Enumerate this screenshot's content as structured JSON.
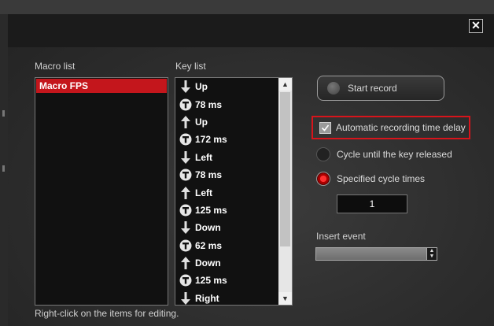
{
  "window": {
    "close_glyph": "✕"
  },
  "macro_list": {
    "label": "Macro list",
    "items": [
      "Macro FPS"
    ]
  },
  "key_list": {
    "label": "Key list",
    "items": [
      {
        "icon": "arrow-down-icon",
        "text": "Up"
      },
      {
        "icon": "timer-icon",
        "text": "78 ms"
      },
      {
        "icon": "arrow-up-icon",
        "text": "Up"
      },
      {
        "icon": "timer-icon",
        "text": "172 ms"
      },
      {
        "icon": "arrow-down-icon",
        "text": "Left"
      },
      {
        "icon": "timer-icon",
        "text": "78 ms"
      },
      {
        "icon": "arrow-up-icon",
        "text": "Left"
      },
      {
        "icon": "timer-icon",
        "text": "125 ms"
      },
      {
        "icon": "arrow-down-icon",
        "text": "Down"
      },
      {
        "icon": "timer-icon",
        "text": "62 ms"
      },
      {
        "icon": "arrow-up-icon",
        "text": "Down"
      },
      {
        "icon": "timer-icon",
        "text": "125 ms"
      },
      {
        "icon": "arrow-down-icon",
        "text": "Right"
      }
    ]
  },
  "record": {
    "start_label": "Start record"
  },
  "options": {
    "auto_delay": {
      "label": "Automatic recording time delay",
      "checked": true
    },
    "cycle_until_release": {
      "label": "Cycle until the key released",
      "selected": false
    },
    "specified_cycle": {
      "label": "Specified cycle times",
      "selected": true
    },
    "cycle_count": "1"
  },
  "insert_event": {
    "label": "Insert event",
    "value": ""
  },
  "footer": {
    "hint": "Right-click on the items for editing."
  },
  "colors": {
    "accent": "#c4161c",
    "highlight_border": "#d8141b",
    "panel_bg": "#111111"
  }
}
